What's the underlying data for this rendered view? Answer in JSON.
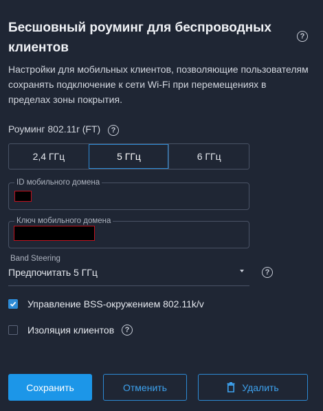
{
  "header": {
    "title": "Бесшовный роуминг для беспроводных клиентов",
    "help_icon": "?"
  },
  "description": "Настройки для мобильных клиентов, позволяющие пользователям сохранять подключение к сети Wi-Fi при перемещениях в пределах зоны покрытия.",
  "roaming": {
    "label": "Роуминг 802.11r (FT)",
    "help_icon": "?",
    "bands": [
      {
        "label": "2,4 ГГц",
        "active": false
      },
      {
        "label": "5 ГГц",
        "active": true
      },
      {
        "label": "6 ГГц",
        "active": false
      }
    ]
  },
  "mobility_domain_id": {
    "label": "ID мобильного домена",
    "value": "[redacted]"
  },
  "mobility_domain_key": {
    "label": "Ключ мобильного домена",
    "value": "[redacted]"
  },
  "band_steering": {
    "label": "Band Steering",
    "value": "Предпочитать 5 ГГц",
    "help_icon": "?"
  },
  "bss_management": {
    "label": "Управление BSS-окружением 802.11k/v",
    "checked": true
  },
  "client_isolation": {
    "label": "Изоляция клиентов",
    "checked": false,
    "help_icon": "?"
  },
  "actions": {
    "save": "Сохранить",
    "cancel": "Отменить",
    "delete": "Удалить"
  },
  "colors": {
    "background": "#1f2634",
    "accent": "#1c96e8",
    "border": "#4a5366"
  }
}
